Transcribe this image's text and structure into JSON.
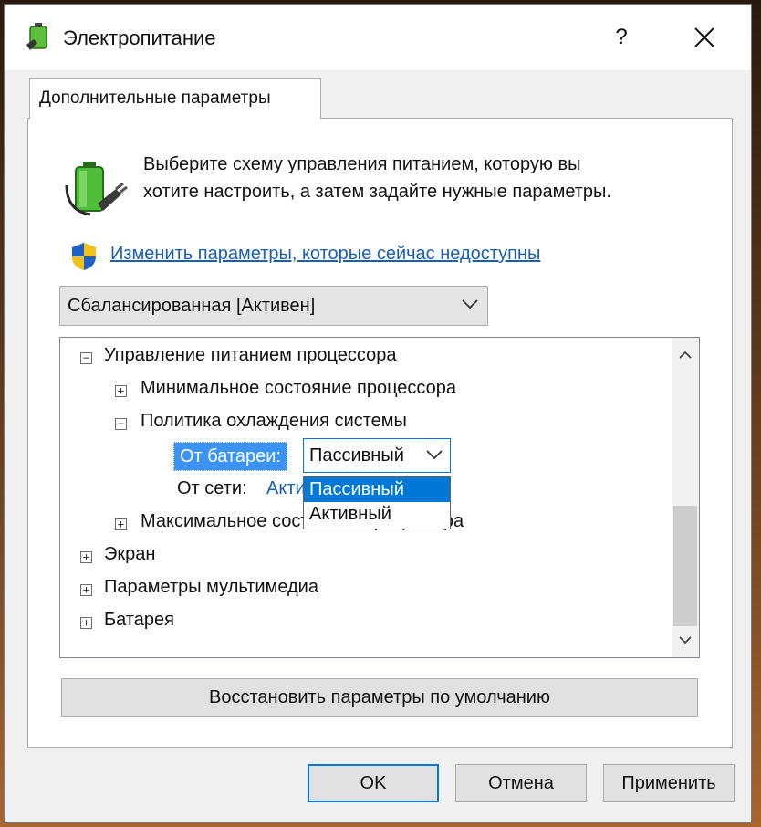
{
  "window": {
    "title": "Электропитание",
    "help_label": "?"
  },
  "tab": {
    "label": "Дополнительные параметры"
  },
  "description": {
    "line1": "Выберите схему управления питанием, которую вы",
    "line2": "хотите настроить, а затем задайте нужные параметры."
  },
  "change_link": "Изменить параметры, которые сейчас недоступны",
  "scheme_select": {
    "value": "Сбалансированная [Активен]"
  },
  "tree": {
    "items": [
      {
        "label": "Управление питанием процессора",
        "expander": "−"
      },
      {
        "label": "Минимальное состояние процессора",
        "expander": "+"
      },
      {
        "label": "Политика охлаждения системы",
        "expander": "−"
      },
      {
        "label": "Максимальное состояние процессора",
        "expander": "+"
      },
      {
        "label": "Экран",
        "expander": "+"
      },
      {
        "label": "Параметры мультимедиа",
        "expander": "+"
      },
      {
        "label": "Батарея",
        "expander": "+"
      }
    ],
    "battery_setting": {
      "label": "От батареи:",
      "value": "Пассивный"
    },
    "ac_setting": {
      "label": "От сети:",
      "value": "Активный"
    },
    "dropdown_options": [
      "Пассивный",
      "Активный"
    ]
  },
  "restore_button": "Восстановить параметры по умолчанию",
  "buttons": {
    "ok": "OK",
    "cancel": "Отмена",
    "apply": "Применить"
  },
  "colors": {
    "accent": "#0078d7",
    "link": "#1a5fb4",
    "highlight": "#3b94f5"
  }
}
